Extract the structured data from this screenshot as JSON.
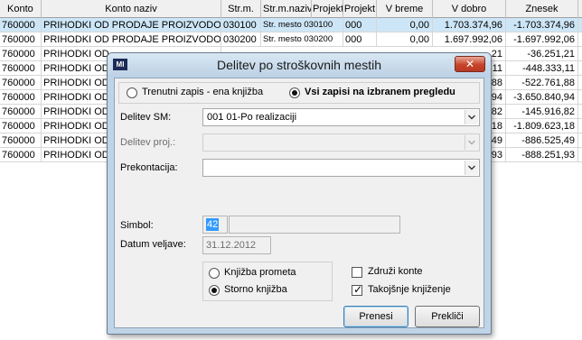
{
  "grid": {
    "headers": [
      "Konto",
      "Konto naziv",
      "Str.m.",
      "Str.m.naziv",
      "Projekt",
      "Projekt",
      "V breme",
      "V dobro",
      "Znesek"
    ],
    "rows": [
      [
        "760000",
        "PRIHODKI OD PRODAJE PROIZVODOV",
        "030100",
        "Str. mesto 030100",
        "000",
        "0,00",
        "1.703.374,96",
        "-1.703.374,96"
      ],
      [
        "760000",
        "PRIHODKI OD PRODAJE PROIZVODOV",
        "030200",
        "Str. mesto 030200",
        "000",
        "0,00",
        "1.697.992,06",
        "-1.697.992,06"
      ],
      [
        "760000",
        "PRIHODKI OD",
        "",
        "",
        "",
        "",
        ",21",
        "-36.251,21"
      ],
      [
        "760000",
        "PRIHODKI OD",
        "",
        "",
        "",
        "",
        ",11",
        "-448.333,11"
      ],
      [
        "760000",
        "PRIHODKI OD",
        "",
        "",
        "",
        "",
        ",88",
        "-522.761,88"
      ],
      [
        "760000",
        "PRIHODKI OD",
        "",
        "",
        "",
        "",
        ",94",
        "-3.650.840,94"
      ],
      [
        "760000",
        "PRIHODKI OD",
        "",
        "",
        "",
        "",
        ",82",
        "-145.916,82"
      ],
      [
        "760000",
        "PRIHODKI OD",
        "",
        "",
        "",
        "",
        ",18",
        "-1.809.623,18"
      ],
      [
        "760000",
        "PRIHODKI OD",
        "",
        "",
        "",
        "",
        ",49",
        "-886.525,49"
      ],
      [
        "760000",
        "PRIHODKI OD",
        "",
        "",
        "",
        "",
        ",93",
        "-888.251,93"
      ]
    ]
  },
  "dialog": {
    "icon_text": "MI",
    "title": "Delitev po stroškovnih mestih",
    "close_label": "✕",
    "scope_option_current": "Trenutni zapis - ena knjižba",
    "scope_option_all": "Vsi zapisi na izbranem pregledu",
    "scope_selected": "all",
    "delitev_sm_label": "Delitev  SM:",
    "delitev_sm_value": "001 01-Po realizaciji",
    "delitev_proj_label": "Delitev proj.:",
    "delitev_proj_value": "",
    "prekontacija_label": "Prekontacija:",
    "prekontacija_value": "",
    "simbol_label": "Simbol:",
    "simbol_value": "42",
    "simbol_name_value": "",
    "datum_label": "Datum veljave:",
    "datum_value": "31.12.2012",
    "posting_option_prometa": "Knjižba prometa",
    "posting_option_storno": "Storno knjižba",
    "posting_selected": "storno",
    "zdruzi_label": "Združi konte",
    "zdruzi_checked": false,
    "takojsnje_label": "Takojšnje knjiženje",
    "takojsnje_checked": true,
    "prenesi_label": "Prenesi",
    "preklici_label": "Prekliči"
  }
}
